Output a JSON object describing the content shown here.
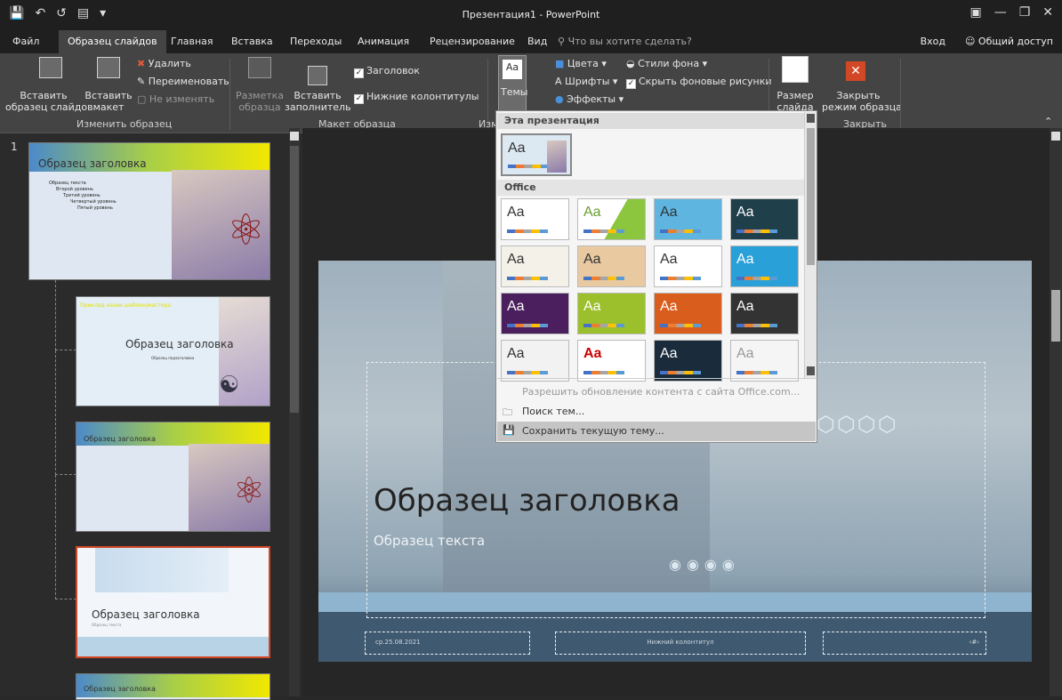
{
  "title": "Презентация1 - PowerPoint",
  "tabs": [
    "Файл",
    "Образец слайдов",
    "Главная",
    "Вставка",
    "Переходы",
    "Анимация",
    "Рецензирование",
    "Вид"
  ],
  "tell_me": "Что вы хотите сделать?",
  "signin": "Вход",
  "share": "Общий доступ",
  "ribbon": {
    "insert_master": [
      "Вставить",
      "образец слайдов"
    ],
    "insert_layout": [
      "Вставить",
      "макет"
    ],
    "delete": "Удалить",
    "rename": "Переименовать",
    "preserve": "Не изменять",
    "group_edit": "Изменить образец",
    "master_layout": [
      "Разметка",
      "образца"
    ],
    "insert_placeholder": [
      "Вставить",
      "заполнитель"
    ],
    "title_check": "Заголовок",
    "footers_check": "Нижние колонтитулы",
    "group_layout": "Макет образца",
    "themes": "Темы",
    "group_edit_theme": "Изм",
    "colors": "Цвета",
    "fonts": "Шрифты",
    "effects": "Эффекты",
    "bg_styles": "Стили фона",
    "hide_bg": "Скрыть фоновые рисунки",
    "slide_size": [
      "Размер",
      "слайда"
    ],
    "close_master": [
      "Закрыть",
      "режим образца"
    ],
    "group_close": "Закрыть"
  },
  "thumbs": {
    "num": "1",
    "t1_title": "Образец заголовка",
    "t1_bullets": [
      "Образец текста",
      "Второй уровень",
      "Третий уровень",
      "Четвертый уровень",
      "Пятый уровень"
    ],
    "t2_banner": "Приклад назви шаблон/мастера",
    "t2_title": "Образец заголовка",
    "t2_sub": "Образец подзаголовка",
    "t3_title": "Образец заголовка",
    "t4_title": "Образец заголовка",
    "t4_sub": "Образец текста",
    "t5_title": "Образец заголовка"
  },
  "slide": {
    "title": "Образец заголовка",
    "subtitle": "Образец текста",
    "date": "ср.25.08.2021",
    "footer": "Нижний колонтитул",
    "num": "‹#›"
  },
  "dropdown": {
    "this_pres": "Эта презентация",
    "office": "Office",
    "aa": "Aa",
    "enable_updates": "Разрешить обновление контента с сайта Office.com...",
    "browse": "Поиск тем...",
    "save": "Сохранить текущую тему..."
  }
}
